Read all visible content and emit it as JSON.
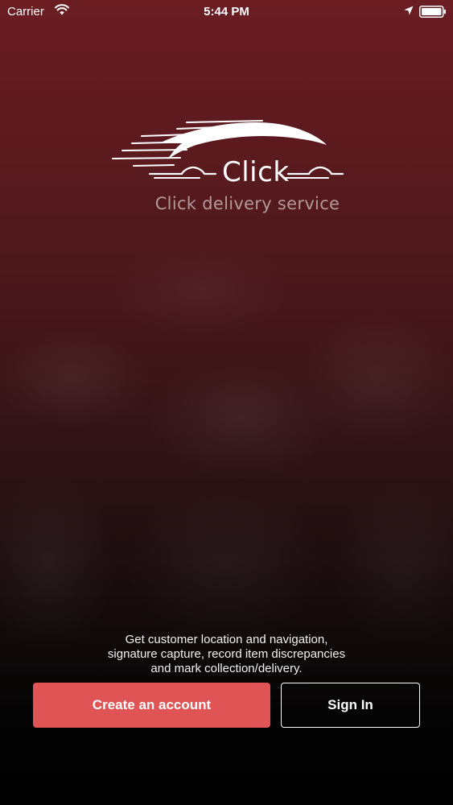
{
  "status_bar": {
    "carrier": "Carrier",
    "time": "5:44 PM",
    "icons": [
      "wifi-icon",
      "location-arrow-icon",
      "battery-icon"
    ]
  },
  "brand": {
    "logo_text": "Click",
    "tagline": "Click delivery service"
  },
  "description": {
    "lines": [
      "Get customer location and navigation,",
      "signature capture, record item discrepancies",
      "and mark collection/delivery."
    ]
  },
  "actions": {
    "create_account_label": "Create an account",
    "sign_in_label": "Sign In"
  },
  "colors": {
    "background_top": "#6b1d22",
    "background_bottom": "#000000",
    "primary_button": "#e15455",
    "text": "#ffffff"
  }
}
